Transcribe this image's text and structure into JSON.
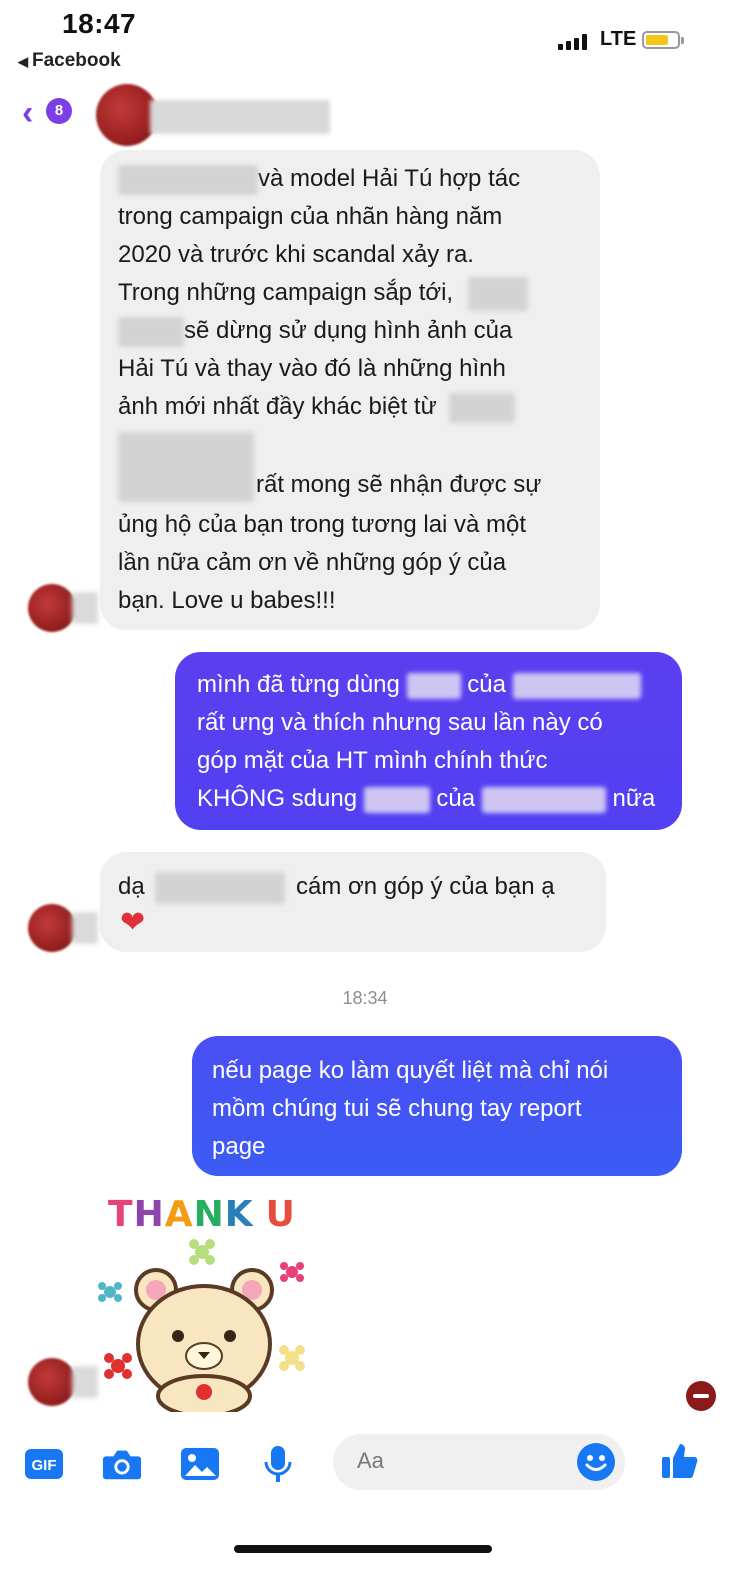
{
  "status_bar": {
    "time": "18:47",
    "back_app": "Facebook",
    "network": "LTE"
  },
  "header": {
    "unread_count": "8"
  },
  "messages": [
    {
      "direction": "incoming",
      "lines": [
        [
          "",
          "và model Hải Tú hợp tác"
        ],
        [
          "trong campaign của nhãn hàng năm"
        ],
        [
          "2020 và trước khi scandal xảy ra."
        ],
        [
          "Trong những campaign sắp tới,",
          ""
        ],
        [
          "",
          "sẽ dừng sử dụng hình ảnh của"
        ],
        [
          "Hải Tú và thay vào đó là những hình"
        ],
        [
          "ảnh mới nhất đầy khác biệt từ",
          ""
        ],
        [
          ""
        ],
        [
          "",
          "rất mong sẽ nhận được sự"
        ],
        [
          "ủng hộ của bạn trong tương lai và một"
        ],
        [
          "lần nữa cảm ơn về những góp ý của"
        ],
        [
          "bạn. Love u babes!!!"
        ]
      ]
    },
    {
      "direction": "outgoing",
      "lines": [
        [
          "mình đã từng dùng",
          "",
          "của",
          ""
        ],
        [
          "rất ưng và thích nhưng sau lần này có"
        ],
        [
          "góp mặt của HT mình chính thức"
        ],
        [
          "KHÔNG sdung",
          "",
          "của",
          "",
          "nữa"
        ]
      ]
    },
    {
      "direction": "incoming",
      "lines": [
        [
          "dạ",
          "",
          "cám ơn góp ý của bạn ạ"
        ]
      ],
      "emoji": "❤"
    },
    {
      "direction": "outgoing",
      "lines": [
        [
          "nếu page ko làm quyết liệt mà chỉ nói"
        ],
        [
          "mồm chúng tui sẽ chung tay report"
        ],
        [
          "page"
        ]
      ]
    }
  ],
  "timestamp": "18:34",
  "sticker": {
    "letters": [
      "T",
      "H",
      "A",
      "N",
      "K",
      " ",
      "U"
    ],
    "colors": [
      "#e8417a",
      "#8e44ad",
      "#f39c12",
      "#27ae60",
      "#2980b9",
      "#ffffff",
      "#e74c3c"
    ]
  },
  "composer": {
    "placeholder": "Aa",
    "icons": [
      "gif-icon",
      "camera-icon",
      "image-icon",
      "microphone-icon",
      "emoji-icon",
      "like-icon"
    ]
  },
  "colors": {
    "accent": "#7b3fe4",
    "messenger_blue": "#1877f2",
    "outgoing_top": "#5b3ff0",
    "outgoing_bottom": "#3b5cf5",
    "incoming_bg": "#efefef"
  }
}
